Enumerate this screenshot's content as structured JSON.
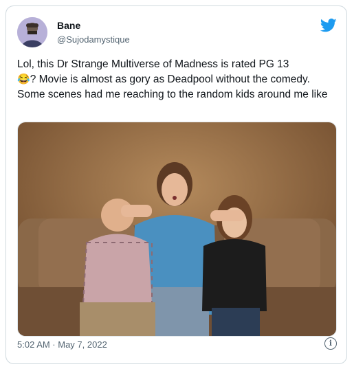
{
  "tweet": {
    "author": {
      "display_name": "Bane",
      "handle": "@Sujodamystique",
      "avatar_icon": "user-avatar"
    },
    "text_part1": "Lol, this Dr Strange Multiverse of Madness is rated PG 13",
    "emoji": "😂",
    "text_part2": "? Movie is almost as gory as Deadpool without the comedy. Some scenes had me reaching to the random kids around me like",
    "timestamp": "5:02 AM · May 7, 2022",
    "info_icon": "i"
  },
  "icons": {
    "twitter_bird": "twitter-bird-icon",
    "info": "info-icon"
  },
  "colors": {
    "brand": "#1d9bf0",
    "text": "#0f1419",
    "secondary_text": "#536471",
    "border": "#cfd9de"
  }
}
